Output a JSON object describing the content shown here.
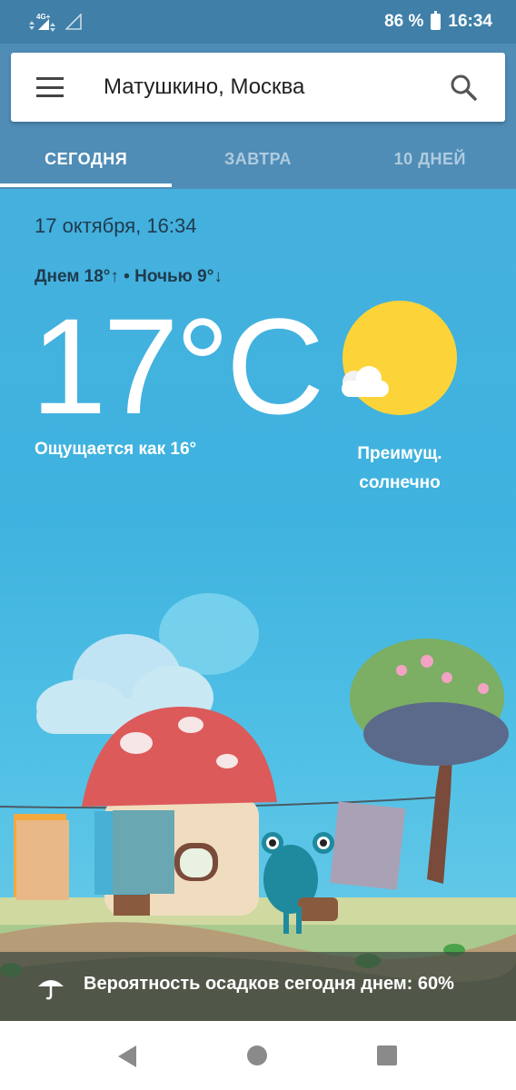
{
  "status_bar": {
    "network_label": "4G+",
    "battery_percent": "86 %",
    "time": "16:34"
  },
  "header": {
    "location": "Матушкино, Москва",
    "tabs": [
      {
        "label": "СЕГОДНЯ",
        "active": true
      },
      {
        "label": "ЗАВТРА",
        "active": false
      },
      {
        "label": "10 ДНЕЙ",
        "active": false
      }
    ]
  },
  "weather": {
    "datetime": "17 октября, 16:34",
    "day_night": "Днем 18°↑ • Ночью 9°↓",
    "temperature": "17°C",
    "feels_like": "Ощущается как 16°",
    "condition_line1": "Преимущ.",
    "condition_line2": "солнечно",
    "condition_icon": "sun-partly-cloudy-icon"
  },
  "precipitation": {
    "icon": "umbrella-icon",
    "text": "Вероятность осадков сегодня днем: 60%"
  },
  "navigation": {
    "back": "back-icon",
    "home": "home-icon",
    "recents": "recents-icon"
  },
  "colors": {
    "status_bar": "#3f7fa8",
    "header": "#4f8db7",
    "sky": "#45b0de",
    "sun": "#fcd439"
  }
}
